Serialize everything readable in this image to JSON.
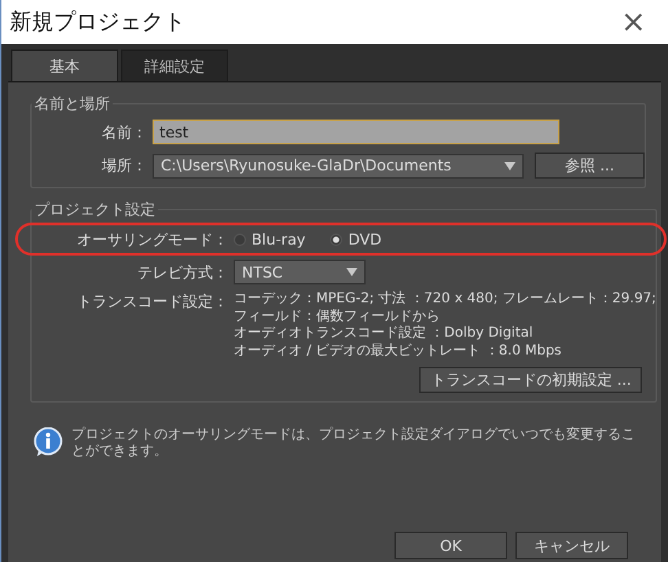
{
  "window": {
    "title": "新規プロジェクト",
    "close": "×"
  },
  "tabs": [
    {
      "label": "基本",
      "selected": true
    },
    {
      "label": "詳細設定",
      "selected": false
    }
  ],
  "name_location": {
    "title": "名前と場所",
    "name_label": "名前：",
    "name_value": "test",
    "location_label": "場所：",
    "location_value": "C:\\Users\\Ryunosuke-GlaDr\\Documents",
    "browse_button": "参照 ..."
  },
  "project_settings": {
    "title": "プロジェクト設定",
    "authoring_label": "オーサリングモード：",
    "authoring_options": [
      {
        "label": "Blu-ray",
        "selected": false
      },
      {
        "label": "DVD",
        "selected": true
      }
    ],
    "tv_label": "テレビ方式：",
    "tv_value": "NTSC",
    "transcode_label": "トランスコード設定：",
    "transcode_lines": [
      "コーデック：MPEG-2; 寸法 ：720 x 480; フレームレート：29.97;",
      "フィールド：偶数フィールドから",
      "オーディオトランスコード設定 ：Dolby Digital",
      "オーディオ / ビデオの最大ビットレート ：8.0 Mbps"
    ],
    "transcode_button": "トランスコードの初期設定 ..."
  },
  "info": "プロジェクトのオーサリングモードは、プロジェクト設定ダイアログでいつでも変更することができます。",
  "buttons": [
    "OK",
    "キャンセル"
  ]
}
